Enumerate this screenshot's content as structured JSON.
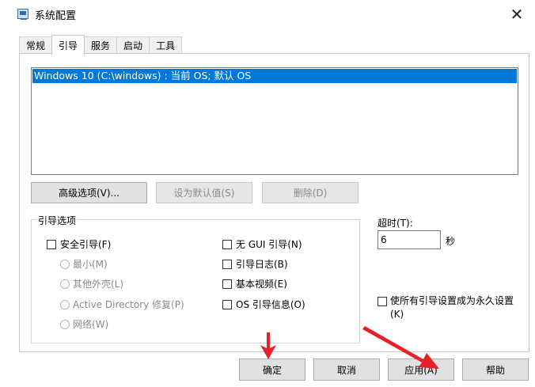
{
  "window": {
    "title": "系统配置",
    "icon": "system-config-icon",
    "close_glyph": "✕"
  },
  "tabs": [
    {
      "label": "常规",
      "active": false
    },
    {
      "label": "引导",
      "active": true
    },
    {
      "label": "服务",
      "active": false
    },
    {
      "label": "启动",
      "active": false
    },
    {
      "label": "工具",
      "active": false
    }
  ],
  "os_list": {
    "items": [
      {
        "label": "Windows 10 (C:\\windows) : 当前 OS; 默认 OS",
        "selected": true
      }
    ],
    "selection_color": "#0078d7"
  },
  "list_buttons": {
    "advanced": "高级选项(V)...",
    "set_default": "设为默认值(S)",
    "delete": "删除(D)"
  },
  "boot_options": {
    "title": "引导选项",
    "safe_boot": {
      "label": "安全引导(F)",
      "checked": false
    },
    "radios": [
      {
        "label": "最小(M)",
        "enabled": false
      },
      {
        "label": "其他外壳(L)",
        "enabled": false
      },
      {
        "label": "Active Directory 修复(P)",
        "enabled": false
      },
      {
        "label": "网络(W)",
        "enabled": false
      }
    ],
    "right_checks": [
      {
        "label": "无 GUI 引导(N)",
        "checked": false
      },
      {
        "label": "引导日志(B)",
        "checked": false
      },
      {
        "label": "基本视频(E)",
        "checked": false
      },
      {
        "label": "OS 引导信息(O)",
        "checked": false
      }
    ]
  },
  "timeout": {
    "label": "超时(T):",
    "value": "6",
    "unit": "秒"
  },
  "permanent": {
    "line1": "使所有引导设置成为永久设置",
    "line2": "(K)",
    "checked": false
  },
  "footer": {
    "ok": "确定",
    "cancel": "取消",
    "apply": "应用(A)",
    "help": "帮助"
  },
  "annotation_color": "#e8202a"
}
